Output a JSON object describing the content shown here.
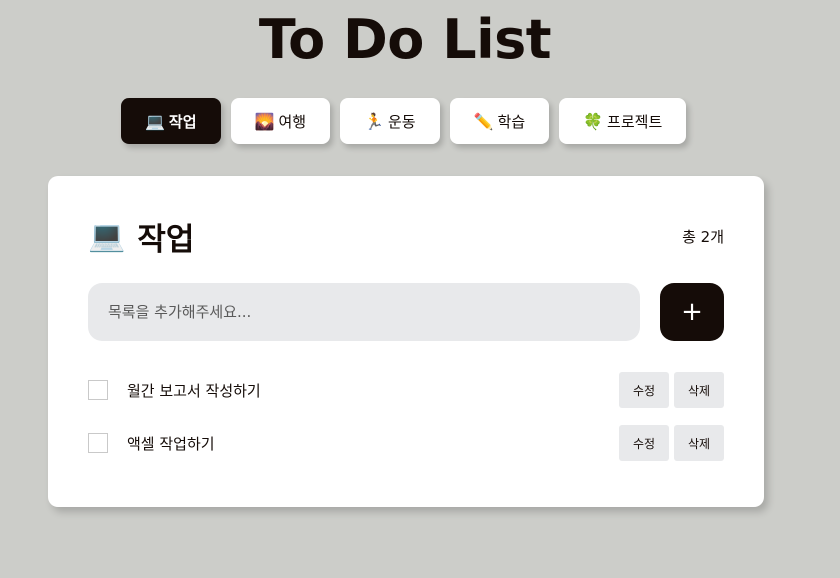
{
  "app": {
    "title": "To Do List"
  },
  "tabs": [
    {
      "icon": "💻",
      "label": "작업",
      "active": true
    },
    {
      "icon": "🌄",
      "label": "여행",
      "active": false
    },
    {
      "icon": "🏃",
      "label": "운동",
      "active": false
    },
    {
      "icon": "✏️",
      "label": "학습",
      "active": false
    },
    {
      "icon": "🍀",
      "label": "프로젝트",
      "active": false
    }
  ],
  "category": {
    "icon": "💻",
    "title": "작업",
    "count_label": "총 2개"
  },
  "input": {
    "placeholder": "목록을 추가해주세요...",
    "value": "",
    "add_label": "+"
  },
  "todos": [
    {
      "text": "월간 보고서 작성하기",
      "checked": false,
      "edit_label": "수정",
      "delete_label": "삭제"
    },
    {
      "text": "액셀 작업하기",
      "checked": false,
      "edit_label": "수정",
      "delete_label": "삭제"
    }
  ],
  "colors": {
    "background": "#cccdc9",
    "accent": "#150c08",
    "card": "#ffffff",
    "input_bg": "#e8e9eb"
  }
}
